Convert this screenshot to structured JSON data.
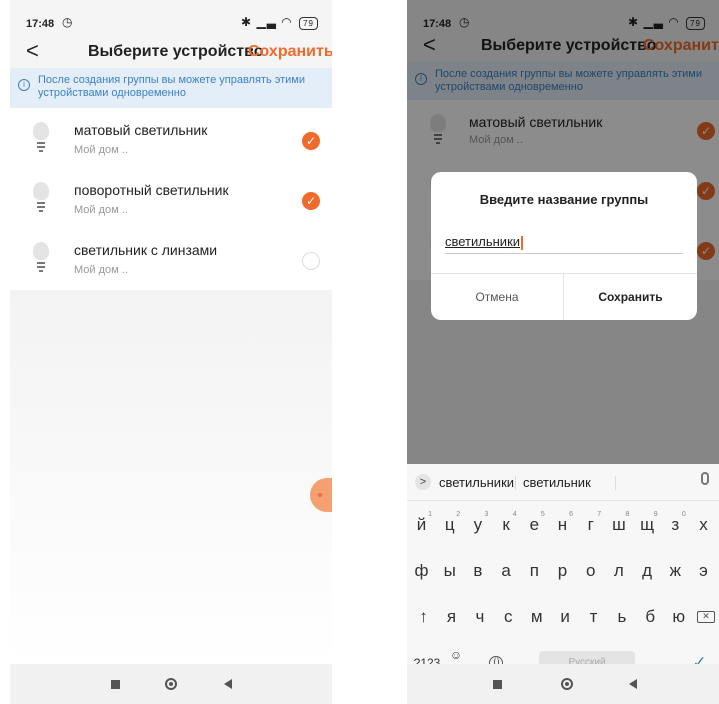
{
  "status": {
    "time": "17:48",
    "battery": "79"
  },
  "header": {
    "title": "Выберите устройство",
    "save_label": "Сохранить",
    "back_label": "<"
  },
  "info_banner": {
    "icon": "info-icon",
    "text": "После создания группы вы можете управлять этими устройствами одновременно"
  },
  "devices": [
    {
      "name": "матовый светильник",
      "location": "Мой дом ..",
      "selected": true
    },
    {
      "name": "поворотный светильник",
      "location": "Мой дом ..",
      "selected": true
    },
    {
      "name": "светильник с линзами",
      "location": "Мой дом ..",
      "selected": false
    }
  ],
  "check_mark": "✓",
  "dialog": {
    "title": "Введите название группы",
    "input_value": "светильники",
    "cancel_label": "Отмена",
    "save_label": "Сохранить"
  },
  "keyboard": {
    "suggestions": [
      "светильники",
      "светильник"
    ],
    "row1": [
      "й",
      "ц",
      "у",
      "к",
      "е",
      "н",
      "г",
      "ш",
      "щ",
      "з",
      "х"
    ],
    "row1_hints": [
      "1",
      "2",
      "3",
      "4",
      "5",
      "6",
      "7",
      "8",
      "9",
      "0",
      ""
    ],
    "row2": [
      "ф",
      "ы",
      "в",
      "а",
      "п",
      "р",
      "о",
      "л",
      "д",
      "ж",
      "э"
    ],
    "row3": [
      "я",
      "ч",
      "с",
      "м",
      "и",
      "т",
      "ь",
      "б",
      "ю"
    ],
    "shift": "↑",
    "backspace": "✕",
    "symbols_label": "?123",
    "emoji_top": "☺",
    "emoji_bottom": ",",
    "space_label": "Русский",
    "period": ".",
    "enter": "✓",
    "suggest_arrow": ">"
  },
  "colors": {
    "accent": "#ef6a2b",
    "info_text": "#3d82c4",
    "info_bg": "#e3eef9"
  }
}
